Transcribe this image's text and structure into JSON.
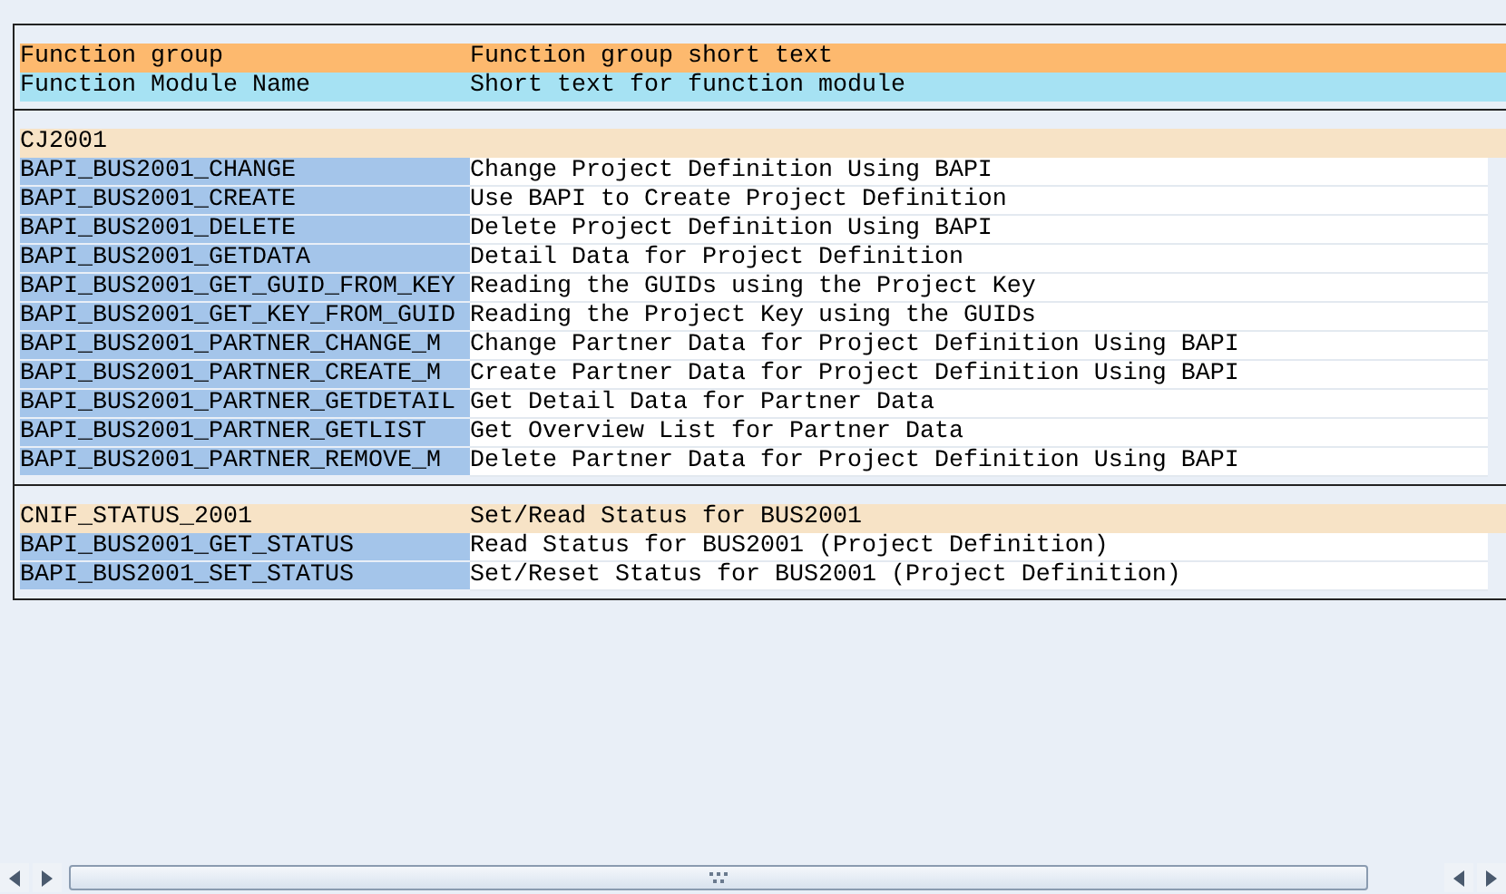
{
  "header": {
    "function_group": "Function group",
    "function_group_short_text": "Function group short text",
    "function_module_name": "Function Module Name",
    "function_module_short_text": "Short text for function module"
  },
  "groups": [
    {
      "name": "CJ2001",
      "modules": [
        {
          "name": "BAPI_BUS2001_CHANGE",
          "short_text": "Change Project Definition Using BAPI"
        },
        {
          "name": "BAPI_BUS2001_CREATE",
          "short_text": "Use BAPI to Create Project Definition"
        },
        {
          "name": "BAPI_BUS2001_DELETE",
          "short_text": "Delete Project Definition Using BAPI"
        },
        {
          "name": "BAPI_BUS2001_GETDATA",
          "short_text": "Detail Data for Project Definition"
        },
        {
          "name": "BAPI_BUS2001_GET_GUID_FROM_KEY",
          "short_text": "Reading the GUIDs using the Project Key"
        },
        {
          "name": "BAPI_BUS2001_GET_KEY_FROM_GUID",
          "short_text": "Reading the Project Key using the GUIDs"
        },
        {
          "name": "BAPI_BUS2001_PARTNER_CHANGE_M",
          "short_text": "Change Partner Data for Project Definition Using BAPI"
        },
        {
          "name": "BAPI_BUS2001_PARTNER_CREATE_M",
          "short_text": "Create Partner Data for Project Definition Using BAPI"
        },
        {
          "name": "BAPI_BUS2001_PARTNER_GETDETAIL",
          "short_text": "Get Detail Data for Partner Data"
        },
        {
          "name": "BAPI_BUS2001_PARTNER_GETLIST",
          "short_text": "Get Overview List for Partner Data"
        },
        {
          "name": "BAPI_BUS2001_PARTNER_REMOVE_M",
          "short_text": "Delete Partner Data for Project Definition Using BAPI"
        }
      ]
    },
    {
      "name": "CNIF_STATUS_2001",
      "short_text": "Set/Read Status for BUS2001",
      "modules": [
        {
          "name": "BAPI_BUS2001_GET_STATUS",
          "short_text": "Read Status for BUS2001 (Project Definition)"
        },
        {
          "name": "BAPI_BUS2001_SET_STATUS",
          "short_text": "Set/Reset Status for BUS2001 (Project Definition)"
        }
      ]
    }
  ]
}
